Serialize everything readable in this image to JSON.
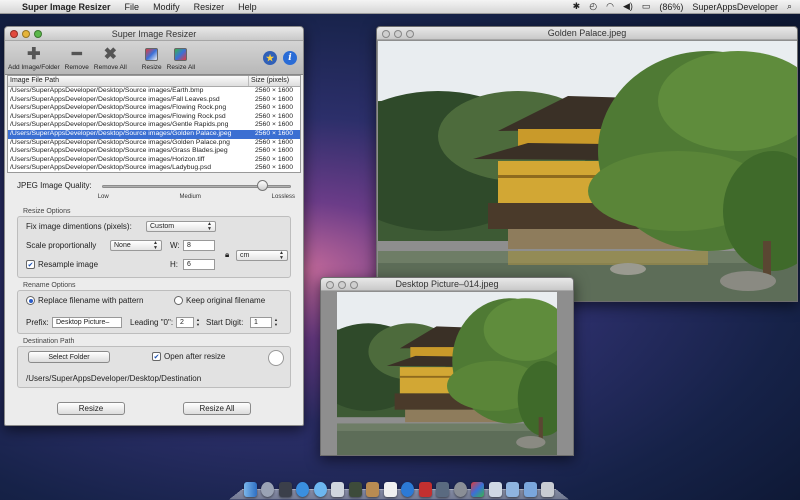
{
  "menubar": {
    "apple": "",
    "app_name": "Super Image Resizer",
    "menus": [
      "File",
      "Modify",
      "Resizer",
      "Help"
    ],
    "battery": "(86%)",
    "user": "SuperAppsDeveloper"
  },
  "main_window": {
    "title": "Super Image Resizer",
    "toolbar": {
      "add": "Add Image/Folder",
      "remove": "Remove",
      "remove_all": "Remove All",
      "resize": "Resize",
      "resize_all": "Resize All"
    },
    "table": {
      "headers": [
        "Image File Path",
        "Size (pixels)"
      ],
      "rows": [
        {
          "path": "/Users/SuperAppsDeveloper/Desktop/Source images/Earth.bmp",
          "size": "2560 × 1600"
        },
        {
          "path": "/Users/SuperAppsDeveloper/Desktop/Source images/Fall Leaves.psd",
          "size": "2560 × 1600"
        },
        {
          "path": "/Users/SuperAppsDeveloper/Desktop/Source images/Flowing Rock.png",
          "size": "2560 × 1600"
        },
        {
          "path": "/Users/SuperAppsDeveloper/Desktop/Source images/Flowing Rock.psd",
          "size": "2560 × 1600"
        },
        {
          "path": "/Users/SuperAppsDeveloper/Desktop/Source images/Gentle Rapids.png",
          "size": "2560 × 1600"
        },
        {
          "path": "/Users/SuperAppsDeveloper/Desktop/Source images/Golden Palace.jpeg",
          "size": "2560 × 1600"
        },
        {
          "path": "/Users/SuperAppsDeveloper/Desktop/Source images/Golden Palace.png",
          "size": "2560 × 1600"
        },
        {
          "path": "/Users/SuperAppsDeveloper/Desktop/Source images/Grass Blades.jpeg",
          "size": "2560 × 1600"
        },
        {
          "path": "/Users/SuperAppsDeveloper/Desktop/Source images/Horizon.tiff",
          "size": "2560 × 1600"
        },
        {
          "path": "/Users/SuperAppsDeveloper/Desktop/Source images/Ladybug.psd",
          "size": "2560 × 1600"
        }
      ],
      "selected_index": 5
    },
    "jpeg_quality": {
      "label": "JPEG Image Quality:",
      "low": "Low",
      "medium": "Medium",
      "lossless": "Lossless",
      "value_percent": 84
    },
    "resize_options": {
      "group_label": "Resize Options",
      "fix_label": "Fix image dimentions (pixels):",
      "fix_value": "Custom",
      "scale_label": "Scale proportionally",
      "scale_value": "None",
      "w_label": "W:",
      "w_value": "8",
      "h_label": "H:",
      "h_value": "6",
      "unit_value": "cm",
      "resample_label": "Resample image",
      "resample_checked": true
    },
    "rename_options": {
      "group_label": "Rename Options",
      "replace_label": "Replace filename with pattern",
      "keep_label": "Keep original filename",
      "prefix_label": "Prefix:",
      "prefix_value": "Desktop Picture–",
      "leading_label": "Leading \"0\":",
      "leading_value": "2",
      "start_label": "Start Digit:",
      "start_value": "1"
    },
    "destination": {
      "group_label": "Destination Path",
      "select_folder": "Select Folder",
      "open_after_label": "Open after resize",
      "open_after_checked": true,
      "path": "/Users/SuperAppsDeveloper/Desktop/Destination"
    },
    "buttons": {
      "resize": "Resize",
      "resize_all": "Resize All"
    }
  },
  "preview_windows": [
    {
      "title": "Golden Palace.jpeg"
    },
    {
      "title": "Desktop Picture–014.jpeg"
    }
  ],
  "icons": {
    "add": "plus-icon",
    "remove": "minus-icon",
    "remove_all": "x-icon",
    "star": "star-icon",
    "info": "info-icon"
  },
  "colors": {
    "selection": "#3b6fd2",
    "close": "#e24b3f",
    "minimize": "#e5b43a",
    "zoom": "#5bb84a"
  }
}
